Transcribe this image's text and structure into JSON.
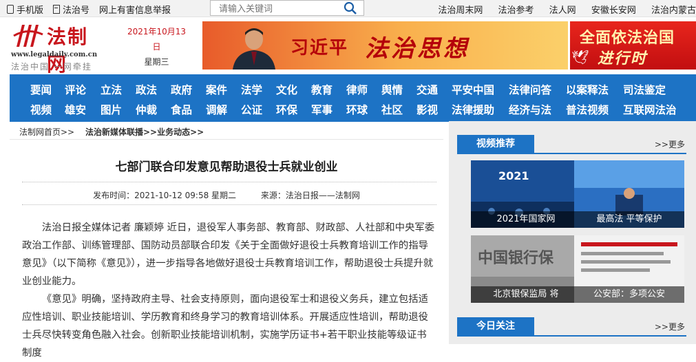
{
  "topbar": {
    "mobile": "手机版",
    "legal_account": "法治号",
    "report": "网上有害信息举报",
    "search_placeholder": "请输入关键词",
    "right_links": [
      "法治周末网",
      "法治参考",
      "法人网",
      "安徽长安网",
      "法治内蒙古"
    ]
  },
  "header": {
    "logo_text": "法制网",
    "logo_url": "www.legaldaily.com.cn",
    "logo_slogan": "法治中国  一网牵挂",
    "date": "2021年10月13日",
    "weekday": "星期三",
    "banner1_title_a": "习近平",
    "banner1_title_b": "法治思想",
    "banner2_line1": "全面依法治国",
    "banner2_line2": "进行时"
  },
  "nav": {
    "row1": [
      "要闻",
      "评论",
      "立法",
      "政法",
      "政府",
      "案件",
      "法学",
      "文化",
      "教育",
      "律师",
      "舆情",
      "交通",
      "平安中国",
      "法律问答",
      "以案释法",
      "司法鉴定"
    ],
    "row2": [
      "视频",
      "雄安",
      "图片",
      "仲裁",
      "食品",
      "调解",
      "公证",
      "环保",
      "军事",
      "环球",
      "社区",
      "影视",
      "法律援助",
      "经济与法",
      "普法视频",
      "互联网法治"
    ]
  },
  "breadcrumb": {
    "home": "法制网首页>>",
    "section": "法治新媒体联播",
    "sub": ">>业务动态>>"
  },
  "article": {
    "title": "七部门联合印发意见帮助退役士兵就业创业",
    "publish_time": "发布时间：2021-10-12 09:58 星期二",
    "source": "来源：法治日报——法制网",
    "paragraphs": [
      "法治日报全媒体记者  廉颖婷  近日，退役军人事务部、教育部、财政部、人社部和中央军委政治工作部、训练管理部、国防动员部联合印发《关于全面做好退役士兵教育培训工作的指导意见》（以下简称《意见》），进一步指导各地做好退役士兵教育培训工作，帮助退役士兵提升就业创业能力。",
      "《意见》明确，坚持政府主导、社会支持原则，面向退役军士和退役义务兵，建立包括适应性培训、职业技能培训、学历教育和终身学习的教育培训体系。开展适应性培训，帮助退役士兵尽快转变角色融入社会。创新职业技能培训机制，实施学历证书+若干职业技能等级证书制度"
    ]
  },
  "sidebar": {
    "video_title": "视频推荐",
    "more": ">>更多",
    "videos": [
      {
        "caption": "2021年国家网"
      },
      {
        "caption": "最高法 平等保护"
      },
      {
        "caption": "北京银保监局 将"
      },
      {
        "caption": "公安部：多项公安"
      }
    ],
    "today_title": "今日关注",
    "today_more": ">>更多"
  }
}
